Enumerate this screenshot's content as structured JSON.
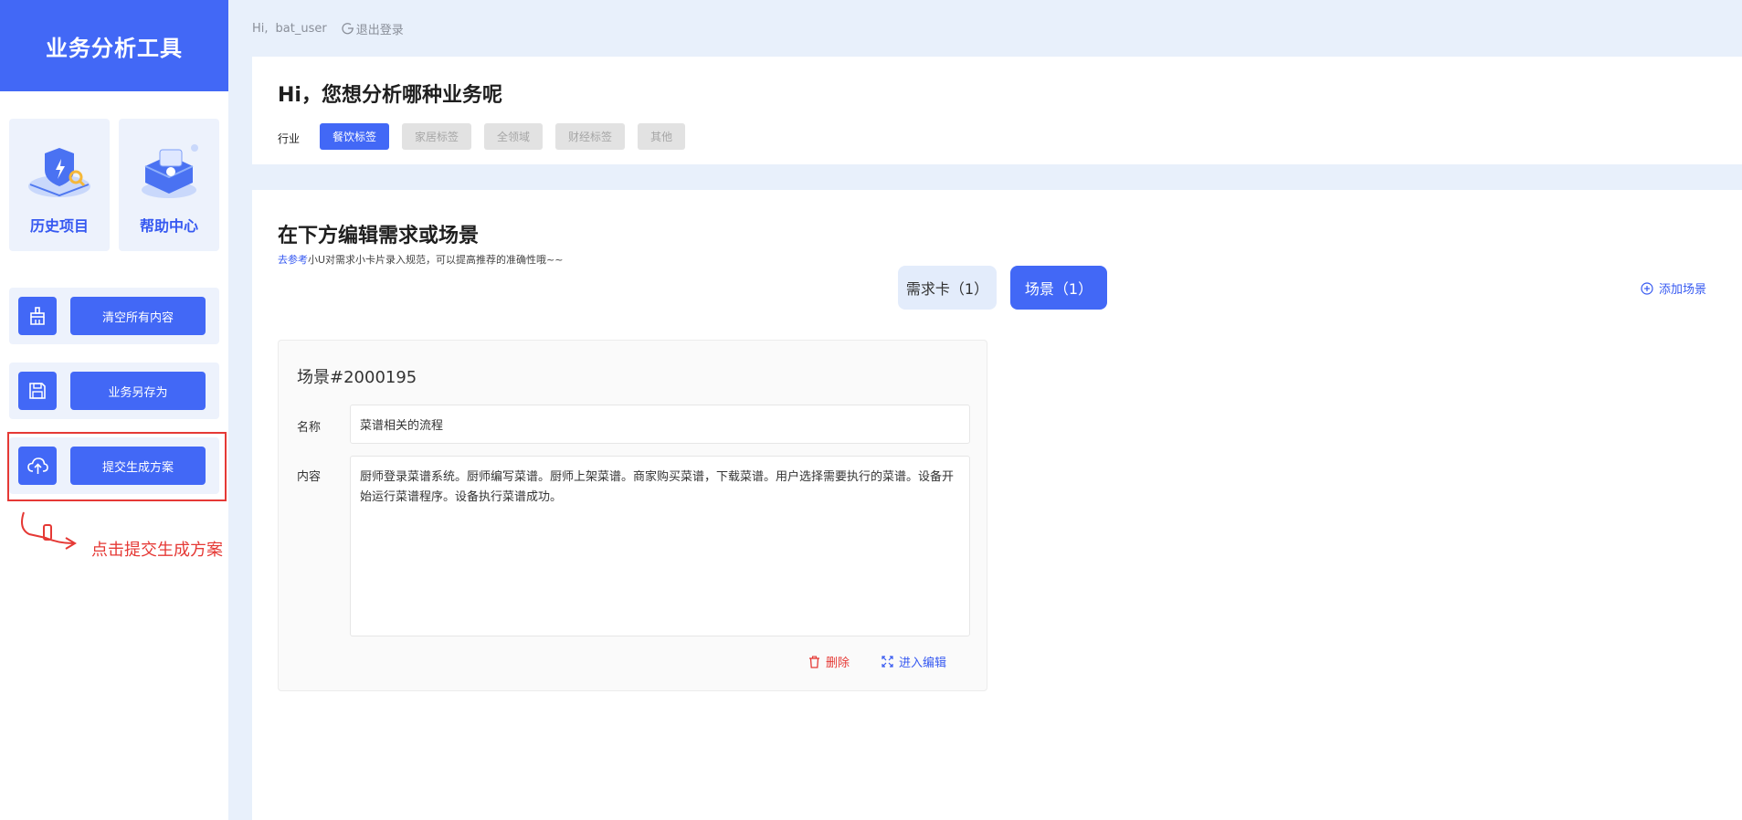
{
  "sidebar": {
    "brand_title": "业务分析工具",
    "quick_links": [
      {
        "label": "历史项目"
      },
      {
        "label": "帮助中心"
      }
    ],
    "actions": [
      {
        "label": "清空所有内容",
        "icon": "broom-icon"
      },
      {
        "label": "业务另存为",
        "icon": "save-icon"
      },
      {
        "label": "提交生成方案",
        "icon": "cloud-upload-icon"
      }
    ],
    "annotation": "点击提交生成方案"
  },
  "topbar": {
    "greeting": "Hi,",
    "username": "bat_user",
    "logout_label": "退出登录"
  },
  "header": {
    "greeting_title": "Hi，您想分析哪种业务呢",
    "industry_label": "行业",
    "tags": [
      {
        "label": "餐饮标签",
        "active": true
      },
      {
        "label": "家居标签",
        "active": false
      },
      {
        "label": "全领域",
        "active": false
      },
      {
        "label": "财经标签",
        "active": false
      },
      {
        "label": "其他",
        "active": false
      }
    ]
  },
  "editor": {
    "title": "在下方编辑需求或场景",
    "hint_link": "去参考",
    "hint_text": "小U对需求小卡片录入规范，可以提高推荐的准确性哦~~",
    "tabs": [
      {
        "label": "需求卡（1）",
        "active": false
      },
      {
        "label": "场景（1）",
        "active": true
      }
    ],
    "add_scene_label": "添加场景",
    "scene": {
      "id": "场景#2000195",
      "name_label": "名称",
      "name_value": "菜谱相关的流程",
      "content_label": "内容",
      "content_value": "厨师登录菜谱系统。厨师编写菜谱。厨师上架菜谱。商家购买菜谱，下载菜谱。用户选择需要执行的菜谱。设备开始运行菜谱程序。设备执行菜谱成功。",
      "delete_label": "删除",
      "edit_label": "进入编辑"
    }
  },
  "colors": {
    "primary": "#4268f6",
    "page_bg": "#e8f0fb",
    "danger": "#e53935",
    "tag_inactive_bg": "#e2e2e2"
  }
}
